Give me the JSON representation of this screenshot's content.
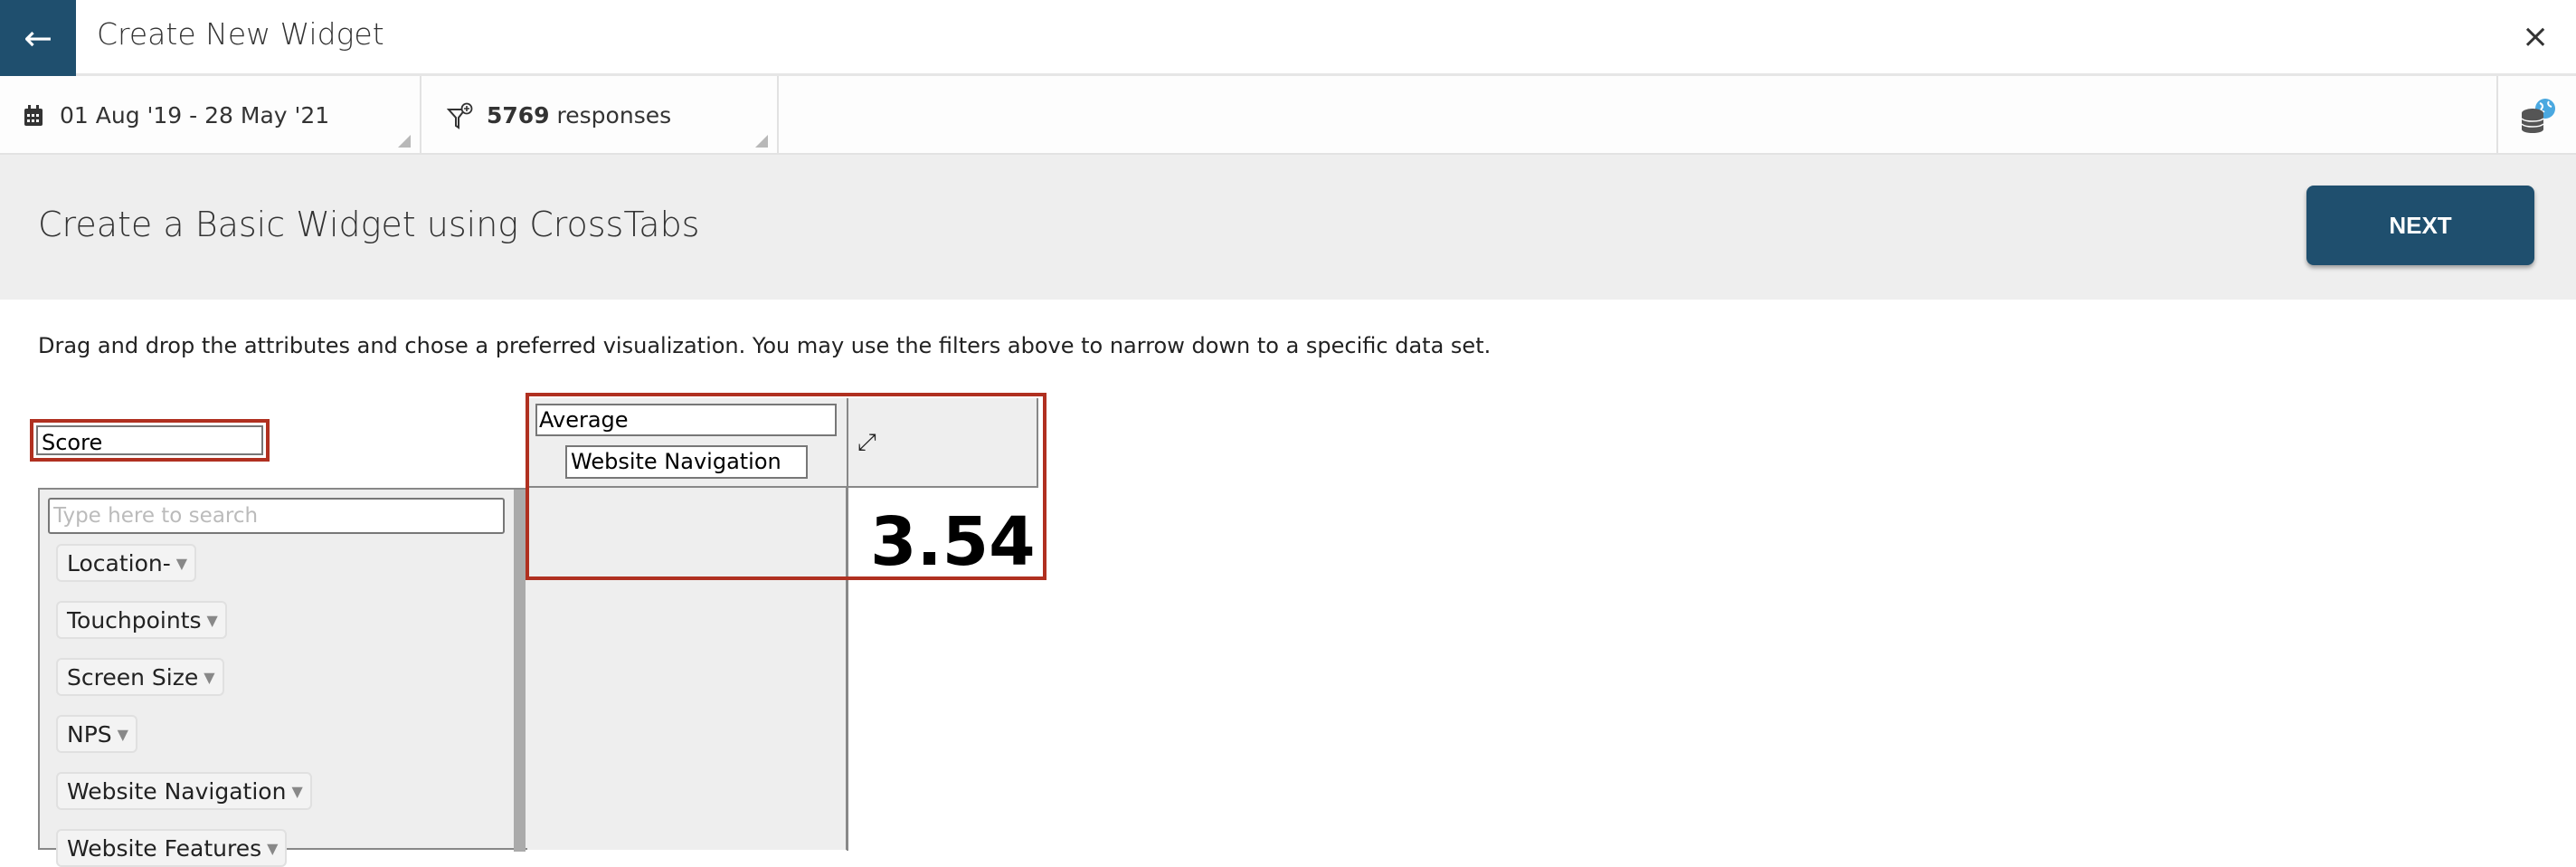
{
  "header": {
    "title": "Create New Widget",
    "back_icon": "arrow-left-icon",
    "close_icon": "close-icon"
  },
  "filters": {
    "date_range": "01 Aug '19 - 28 May '21",
    "response_count": "5769",
    "response_label": "responses",
    "date_icon": "calendar-icon",
    "filter_icon": "filter-plus-icon",
    "datasource_icon": "database-globe-icon"
  },
  "band": {
    "title": "Create a Basic Widget using CrossTabs",
    "next_label": "NEXT"
  },
  "description": "Drag and drop the attributes and chose a preferred visualization. You may use the filters above to narrow down to a specific data set.",
  "score_field": "Score",
  "attributes": {
    "search_placeholder": "Type here to search",
    "items": [
      "Location-",
      "Touchpoints",
      "Screen Size",
      "NPS",
      "Website Navigation",
      "Website Features"
    ]
  },
  "crosstab": {
    "measure": "Average",
    "row_attribute": "Website Navigation",
    "value": "3.54"
  },
  "colors": {
    "primary": "#1f4f6e",
    "highlight": "#b03020",
    "globe": "#4aa8e0"
  }
}
